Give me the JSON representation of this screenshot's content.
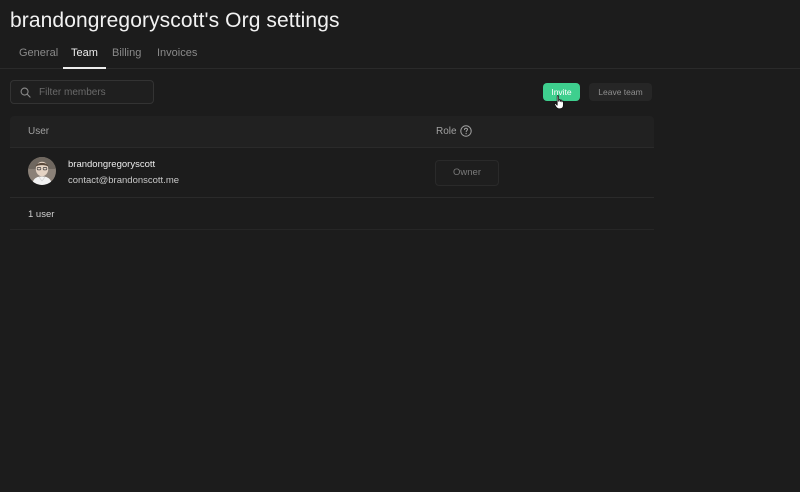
{
  "page": {
    "title": "brandongregoryscott's Org settings"
  },
  "tabs": [
    {
      "label": "General",
      "active": false
    },
    {
      "label": "Team",
      "active": true
    },
    {
      "label": "Billing",
      "active": false
    },
    {
      "label": "Invoices",
      "active": false
    }
  ],
  "toolbar": {
    "filter_placeholder": "Filter members",
    "filter_value": "",
    "invite_label": "Invite",
    "leave_label": "Leave team"
  },
  "table": {
    "columns": {
      "user": "User",
      "role": "Role"
    },
    "rows": [
      {
        "name": "brandongregoryscott",
        "email": "contact@brandonscott.me",
        "role": "Owner"
      }
    ],
    "footer": "1 user"
  },
  "colors": {
    "background": "#1c1c1c",
    "accent": "#3ecf8e"
  },
  "icons": [
    "search-icon",
    "help-circle-icon",
    "hand-pointer-icon"
  ]
}
